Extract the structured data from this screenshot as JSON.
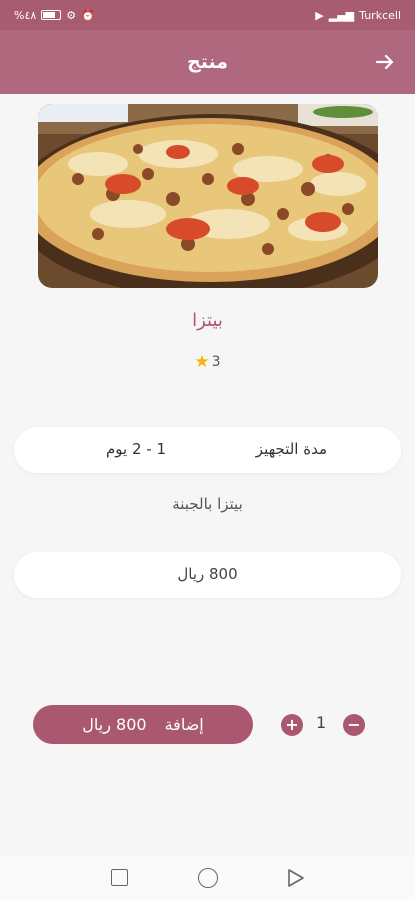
{
  "status_bar": {
    "left_text": "%٤٨",
    "carrier": "Turkcell"
  },
  "header": {
    "title": "منتج"
  },
  "product": {
    "name": "بيتزا",
    "rating": "3",
    "prep_label": "مدة التجهيز",
    "prep_value": "1  -  2 يوم",
    "description": "بيتزا بالجبنة",
    "price": "800   ريال"
  },
  "cart": {
    "quantity": "1",
    "add_label": "إضافة",
    "add_price": "800  ريال"
  },
  "colors": {
    "header": "#b0687f",
    "status_bar": "#a85c72",
    "accent": "#a9586f",
    "title": "#b0576f",
    "star": "#f2b705"
  },
  "icons": {
    "back": "arrow-right-icon",
    "star": "star-icon",
    "plus": "plus-icon",
    "minus": "minus-icon"
  }
}
